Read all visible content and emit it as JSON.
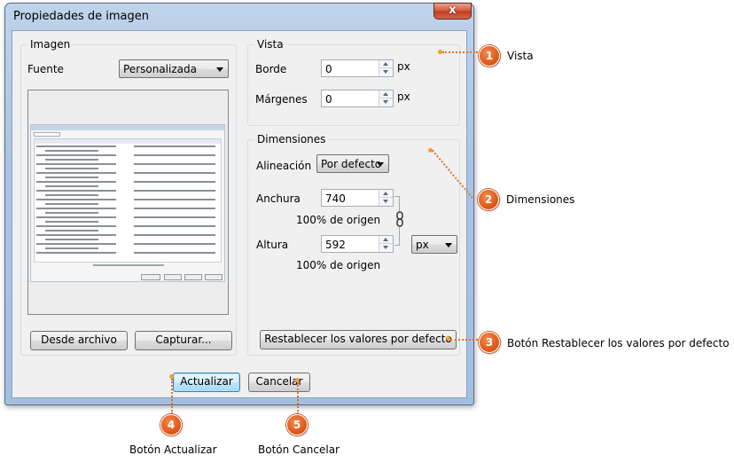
{
  "window": {
    "title": "Propiedades de imagen",
    "close_glyph": "x"
  },
  "imagen": {
    "legend": "Imagen",
    "source_label": "Fuente",
    "source_value": "Personalizada",
    "from_file_button": "Desde archivo",
    "capture_button": "Capturar..."
  },
  "vista": {
    "legend": "Vista",
    "border_label": "Borde",
    "border_value": "0",
    "border_unit": "px",
    "margins_label": "Márgenes",
    "margins_value": "0",
    "margins_unit": "px"
  },
  "dimensiones": {
    "legend": "Dimensiones",
    "alignment_label": "Alineación",
    "alignment_value": "Por defecto",
    "width_label": "Anchura",
    "width_value": "740",
    "width_note": "100% de origen",
    "height_label": "Altura",
    "height_value": "592",
    "height_note": "100% de origen",
    "unit_value": "px",
    "reset_button": "Restablecer los valores por defecto"
  },
  "footer": {
    "update_button": "Actualizar",
    "cancel_button": "Cancelar"
  },
  "callouts": [
    {
      "num": "1",
      "text": "Vista"
    },
    {
      "num": "2",
      "text": "Dimensiones"
    },
    {
      "num": "3",
      "text": "Botón Restablecer los valores por defecto"
    },
    {
      "num": "4",
      "text": "Botón Actualizar"
    },
    {
      "num": "5",
      "text": "Botón Cancelar"
    }
  ],
  "colors": {
    "callout": "#e05a18",
    "title_bar": "#aac5e3",
    "dialog_bg": "#f0f0f0"
  }
}
